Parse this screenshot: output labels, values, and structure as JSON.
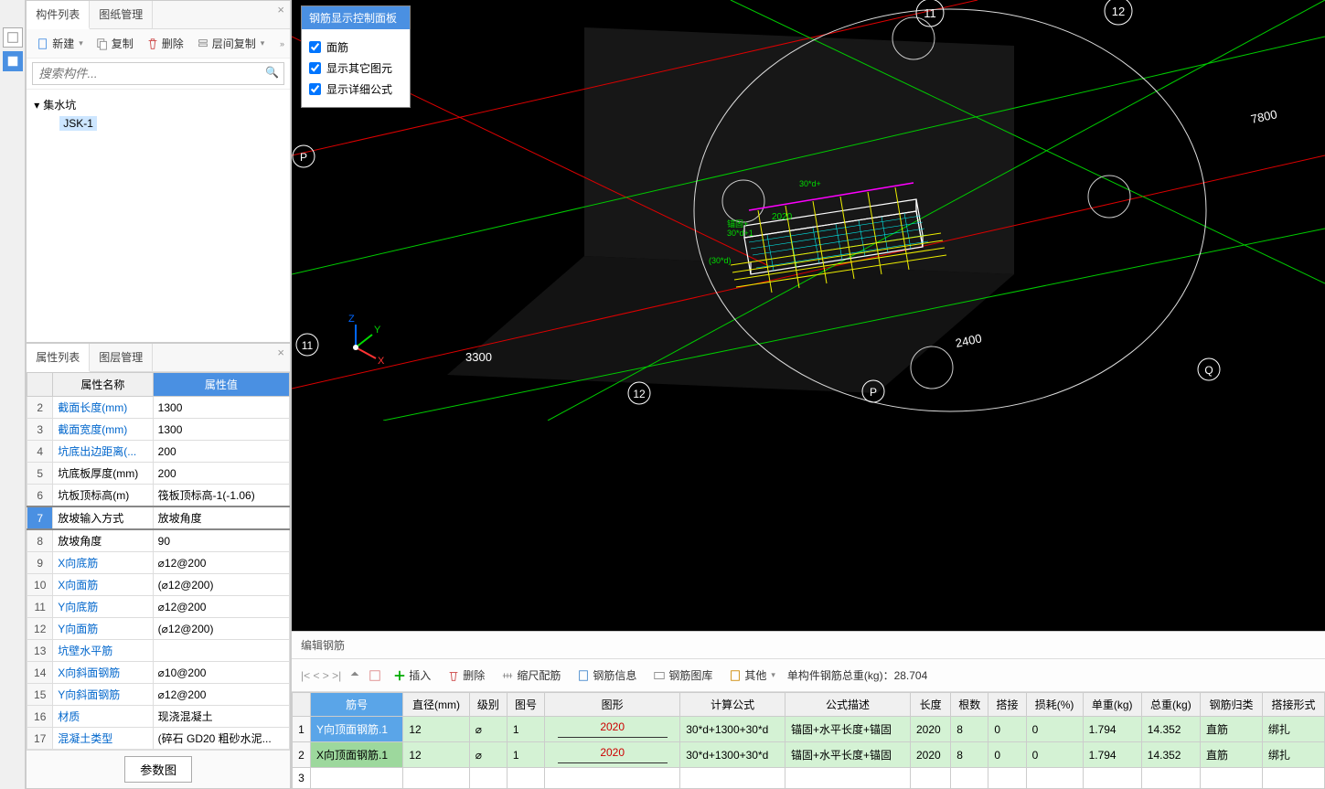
{
  "componentPanel": {
    "tabs": [
      "构件列表",
      "图纸管理"
    ],
    "activeTab": 0,
    "toolbar": {
      "new": "新建",
      "copy": "复制",
      "delete": "删除",
      "floorCopy": "层间复制"
    },
    "searchPlaceholder": "搜索构件...",
    "tree": {
      "root": "集水坑",
      "child": "JSK-1"
    }
  },
  "propertyPanel": {
    "tabs": [
      "属性列表",
      "图层管理"
    ],
    "activeTab": 0,
    "headers": {
      "name": "属性名称",
      "value": "属性值"
    },
    "rows": [
      {
        "idx": "2",
        "name": "截面长度(mm)",
        "value": "1300",
        "link": true
      },
      {
        "idx": "3",
        "name": "截面宽度(mm)",
        "value": "1300",
        "link": true
      },
      {
        "idx": "4",
        "name": "坑底出边距离(...",
        "value": "200",
        "link": true
      },
      {
        "idx": "5",
        "name": "坑底板厚度(mm)",
        "value": "200",
        "link": false
      },
      {
        "idx": "6",
        "name": "坑板顶标高(m)",
        "value": "筏板顶标高-1(-1.06)",
        "link": false
      },
      {
        "idx": "7",
        "name": "放坡输入方式",
        "value": "放坡角度",
        "link": false,
        "selected": true
      },
      {
        "idx": "8",
        "name": "放坡角度",
        "value": "90",
        "link": false
      },
      {
        "idx": "9",
        "name": "X向底筋",
        "value": "⌀12@200",
        "link": true
      },
      {
        "idx": "10",
        "name": "X向面筋",
        "value": "(⌀12@200)",
        "link": true
      },
      {
        "idx": "11",
        "name": "Y向底筋",
        "value": "⌀12@200",
        "link": true
      },
      {
        "idx": "12",
        "name": "Y向面筋",
        "value": "(⌀12@200)",
        "link": true
      },
      {
        "idx": "13",
        "name": "坑壁水平筋",
        "value": "",
        "link": true
      },
      {
        "idx": "14",
        "name": "X向斜面钢筋",
        "value": "⌀10@200",
        "link": true
      },
      {
        "idx": "15",
        "name": "Y向斜面钢筋",
        "value": "⌀12@200",
        "link": true
      },
      {
        "idx": "16",
        "name": "材质",
        "value": "现浇混凝土",
        "link": true
      },
      {
        "idx": "17",
        "name": "混凝土类型",
        "value": "(碎石 GD20 粗砂水泥...",
        "link": true
      }
    ],
    "paramBtn": "参数图"
  },
  "rebarDisplay": {
    "title": "钢筋显示控制面板",
    "items": [
      "面筋",
      "显示其它图元",
      "显示详细公式"
    ]
  },
  "viewport": {
    "gridLabels": {
      "p": "P",
      "q": "Q",
      "n11": "11",
      "n12": "12"
    },
    "dims": {
      "d3300": "3300",
      "d2400": "2400",
      "d7800": "7800",
      "d2020": "2020"
    },
    "formula1": "30*d+",
    "formula2": "(30*d)",
    "formula3": "锚固+",
    "formula4": "30*d+1"
  },
  "editPanel": {
    "title": "编辑钢筋",
    "toolbar": {
      "insert": "插入",
      "delete": "删除",
      "scale": "缩尺配筋",
      "info": "钢筋信息",
      "lib": "钢筋图库",
      "other": "其他",
      "total": "单构件钢筋总重(kg)：28.704"
    },
    "headers": [
      "筋号",
      "直径(mm)",
      "级别",
      "图号",
      "图形",
      "计算公式",
      "公式描述",
      "长度",
      "根数",
      "搭接",
      "损耗(%)",
      "单重(kg)",
      "总重(kg)",
      "钢筋归类",
      "搭接形式"
    ],
    "rows": [
      {
        "idx": "1",
        "name": "Y向顶面钢筋.1",
        "dia": "12",
        "grade": "⌀",
        "pic": "1",
        "shape": "2020",
        "formula": "30*d+1300+30*d",
        "desc": "锚固+水平长度+锚固",
        "len": "2020",
        "count": "8",
        "lap": "0",
        "loss": "0",
        "uw": "1.794",
        "tw": "14.352",
        "cat": "直筋",
        "laptype": "绑扎",
        "selected": true
      },
      {
        "idx": "2",
        "name": "X向顶面钢筋.1",
        "dia": "12",
        "grade": "⌀",
        "pic": "1",
        "shape": "2020",
        "formula": "30*d+1300+30*d",
        "desc": "锚固+水平长度+锚固",
        "len": "2020",
        "count": "8",
        "lap": "0",
        "loss": "0",
        "uw": "1.794",
        "tw": "14.352",
        "cat": "直筋",
        "laptype": "绑扎"
      }
    ]
  }
}
